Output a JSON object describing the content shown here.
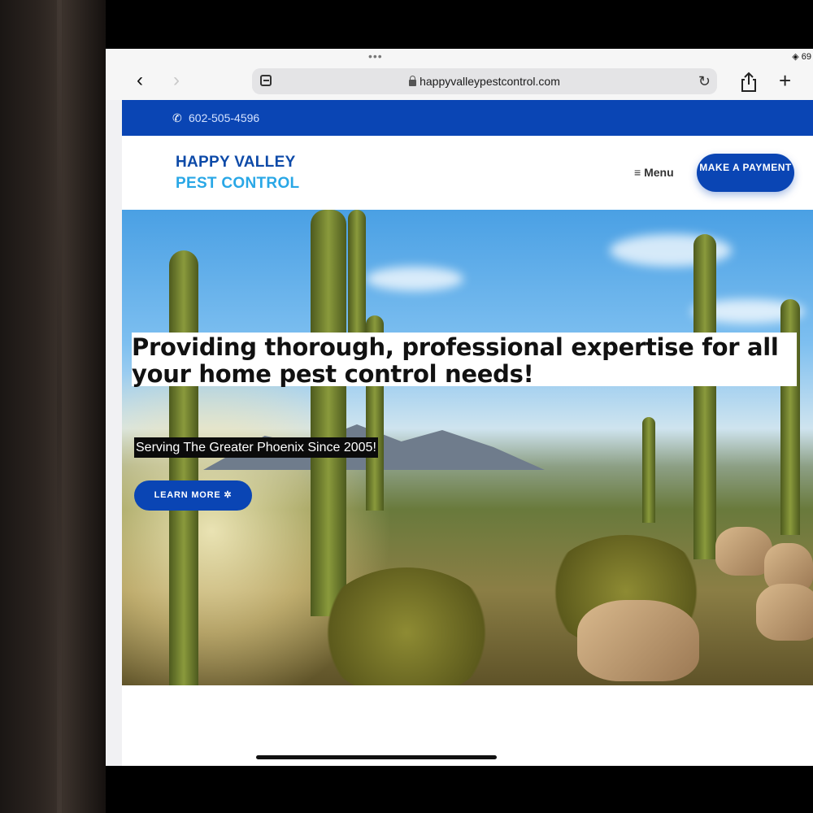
{
  "browser": {
    "status": "◈ 69",
    "url": "happyvalleypestcontrol.com",
    "icons": [
      "tabs-icon",
      "lock-icon",
      "reload-icon",
      "share-icon",
      "plus-icon",
      "back-icon",
      "forward-icon"
    ]
  },
  "site": {
    "phone": "602-505-4596",
    "logo_line1": "HAPPY VALLEY",
    "logo_line2": "PEST CONTROL",
    "menu_label": "Menu",
    "pay_button": "MAKE A PAYMENT",
    "headline_line1": "Providing thorough, professional expertise for all",
    "headline_line2": "your home pest control needs!",
    "tagline": "Serving The Greater Phoenix Since 2005!",
    "learn_more": "LEARN MORE"
  },
  "colors": {
    "brand_blue": "#0a45b4",
    "logo_dark_blue": "#0d4aa8",
    "logo_light_blue": "#29a7e6"
  }
}
